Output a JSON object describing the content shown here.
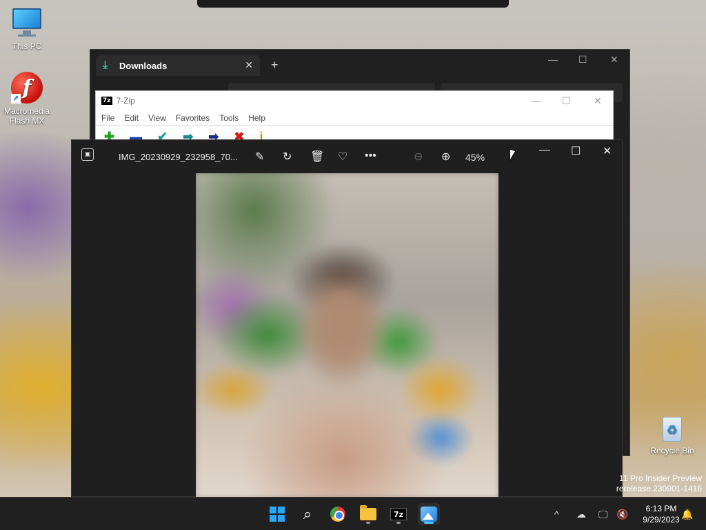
{
  "desktop": {
    "icons": [
      {
        "label": "This PC"
      },
      {
        "label": "Macromedia Flash MX"
      },
      {
        "label": "Recycle Bin"
      }
    ],
    "watermark_line1": "11 Pro Insider Preview",
    "watermark_line2": "rerelease.230901-1416"
  },
  "explorer": {
    "tab_label": "Downloads",
    "tab_close": "✕",
    "new_tab": "+",
    "minimize": "—",
    "maximize": "☐",
    "close": "✕"
  },
  "sevenzip": {
    "logo": "7z",
    "title": "7-Zip",
    "menu": [
      "File",
      "Edit",
      "View",
      "Favorites",
      "Tools",
      "Help"
    ],
    "minimize": "—",
    "maximize": "☐",
    "close": "✕"
  },
  "photos": {
    "filename": "IMG_20230929_232958_70...",
    "zoom": "45%",
    "minimize": "—",
    "maximize": "☐",
    "close": "✕"
  },
  "taskbar": {
    "clock_time": "6:13 PM",
    "clock_date": "9/29/2023",
    "tray_chevron": "^"
  },
  "colors": {
    "accent": "#4cc2ff",
    "taskbar_bg": "#202020",
    "photos_bg": "#1f1f1f"
  }
}
